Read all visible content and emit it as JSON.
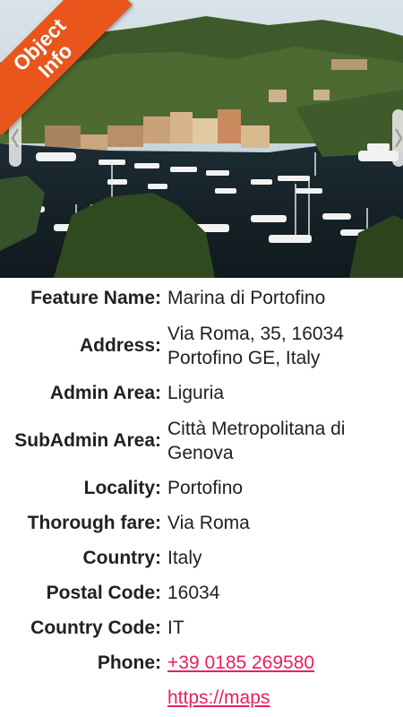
{
  "banner": {
    "line1": "Object",
    "line2": "Info",
    "color": "#e8561c"
  },
  "hero": {
    "icons": {
      "prev": "chevron-left-icon",
      "next": "chevron-right-icon"
    }
  },
  "fields": [
    {
      "label": "Feature Name:",
      "value": "Marina di Portofino"
    },
    {
      "label": "Address:",
      "value": "Via Roma, 35, 16034 Portofino GE, Italy"
    },
    {
      "label": "Admin Area:",
      "value": "Liguria"
    },
    {
      "label": "SubAdmin Area:",
      "value": "Città Metropolitana di Genova"
    },
    {
      "label": "Locality:",
      "value": "Portofino"
    },
    {
      "label": "Thorough fare:",
      "value": "Via Roma"
    },
    {
      "label": "Country:",
      "value": "Italy"
    },
    {
      "label": "Postal Code:",
      "value": "16034"
    },
    {
      "label": "Country Code:",
      "value": "IT"
    },
    {
      "label": "Phone:",
      "value": "+39 0185 269580"
    },
    {
      "label": "",
      "value": "https://maps"
    }
  ],
  "colors": {
    "link": "#e91e63",
    "text": "#212121"
  }
}
